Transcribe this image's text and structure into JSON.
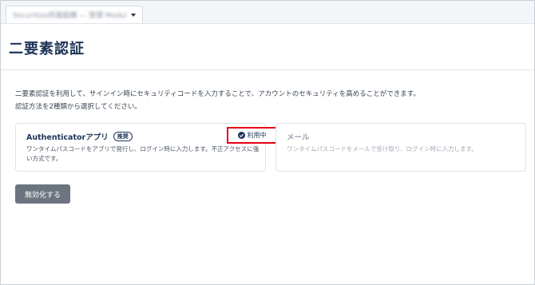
{
  "header": {
    "account_selector": "Securities所属組織 — 管理 Module"
  },
  "page": {
    "title": "二要素認証",
    "description_line1": "二要素認証を利用して、サインイン時にセキュリティコードを入力することで、アカウントのセキュリティを高めることができます。",
    "description_line2": "認証方法を2種類から選択してください。"
  },
  "methods": [
    {
      "title": "Authenticatorアプリ",
      "badge": "推奨",
      "status": "利用中",
      "description": "ワンタイムパスコードをアプリで発行し、ログイン時に入力します。不正アクセスに強い方式です。"
    },
    {
      "title": "メール",
      "description": "ワンタイムパスコードをメールで受け取り、ログイン時に入力します。"
    }
  ],
  "actions": {
    "disable_label": "無効化する"
  },
  "colors": {
    "brand_navy": "#1f3558",
    "highlight_red": "#e60012",
    "button_gray": "#6c757f"
  },
  "icons": {
    "status": "check-circle-icon",
    "account_menu": "chevron-down-icon"
  }
}
